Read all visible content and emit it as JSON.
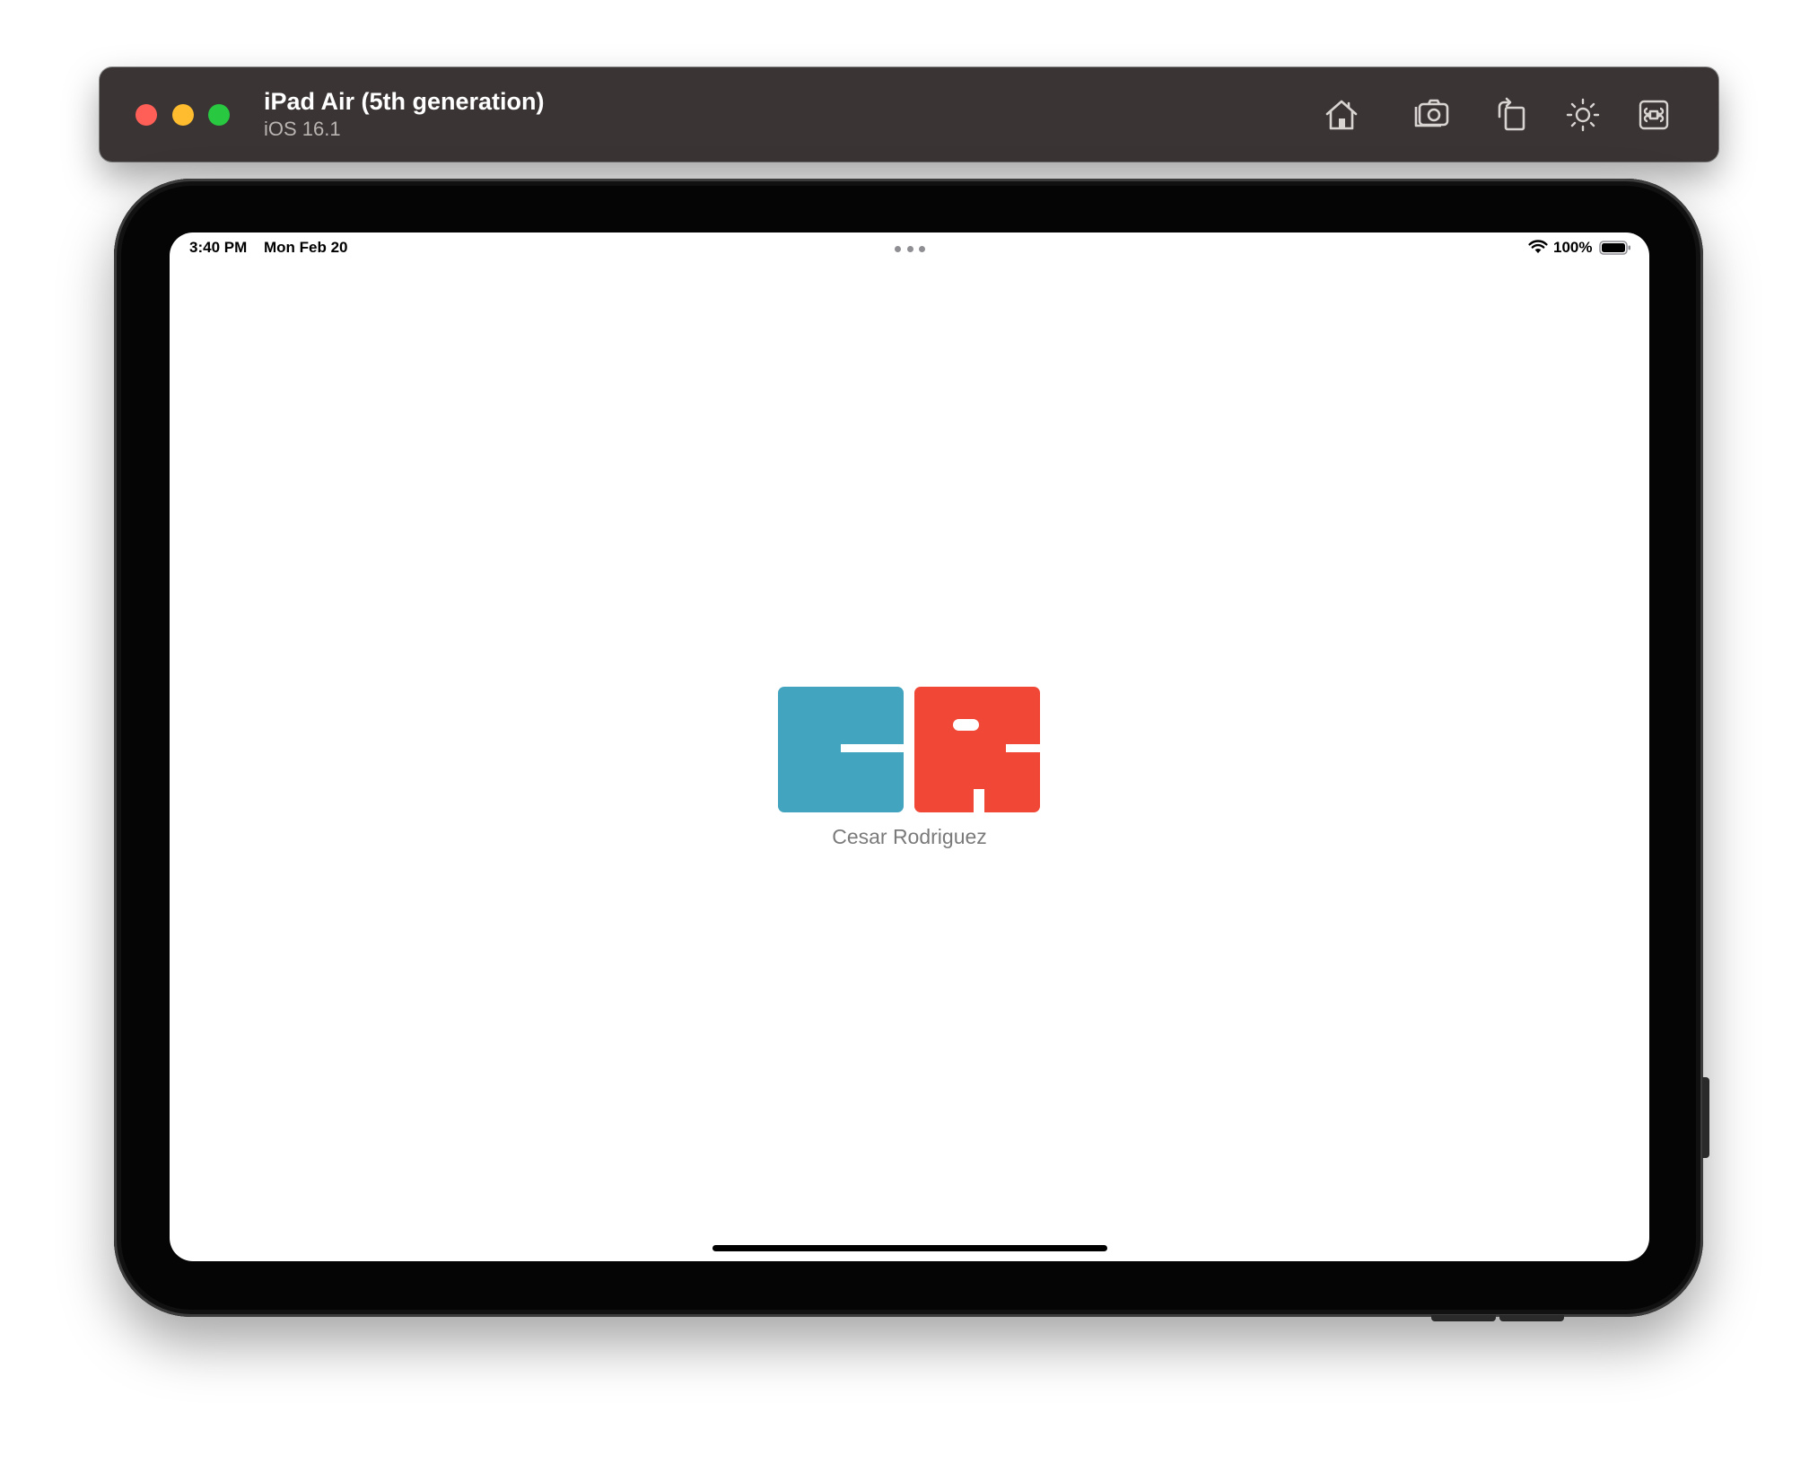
{
  "window": {
    "device_name": "iPad Air (5th generation)",
    "os_version": "iOS 16.1",
    "toolbar": {
      "home_icon": "home-icon",
      "screenshot_icon": "camera-icon",
      "rotate_icon": "rotate-icon",
      "appearance_icon": "sun-icon",
      "command_icon": "command-icon"
    },
    "traffic_lights": {
      "close_color": "#ff5f57",
      "minimize_color": "#febc2e",
      "zoom_color": "#28c840"
    }
  },
  "status_bar": {
    "time": "3:40 PM",
    "date": "Mon Feb 20",
    "battery": "100%",
    "wifi_icon": "wifi-icon",
    "battery_icon": "battery-icon"
  },
  "splash": {
    "logo_left_color": "#43a4bf",
    "logo_right_color": "#f04736",
    "caption": "Cesar Rodriguez"
  }
}
